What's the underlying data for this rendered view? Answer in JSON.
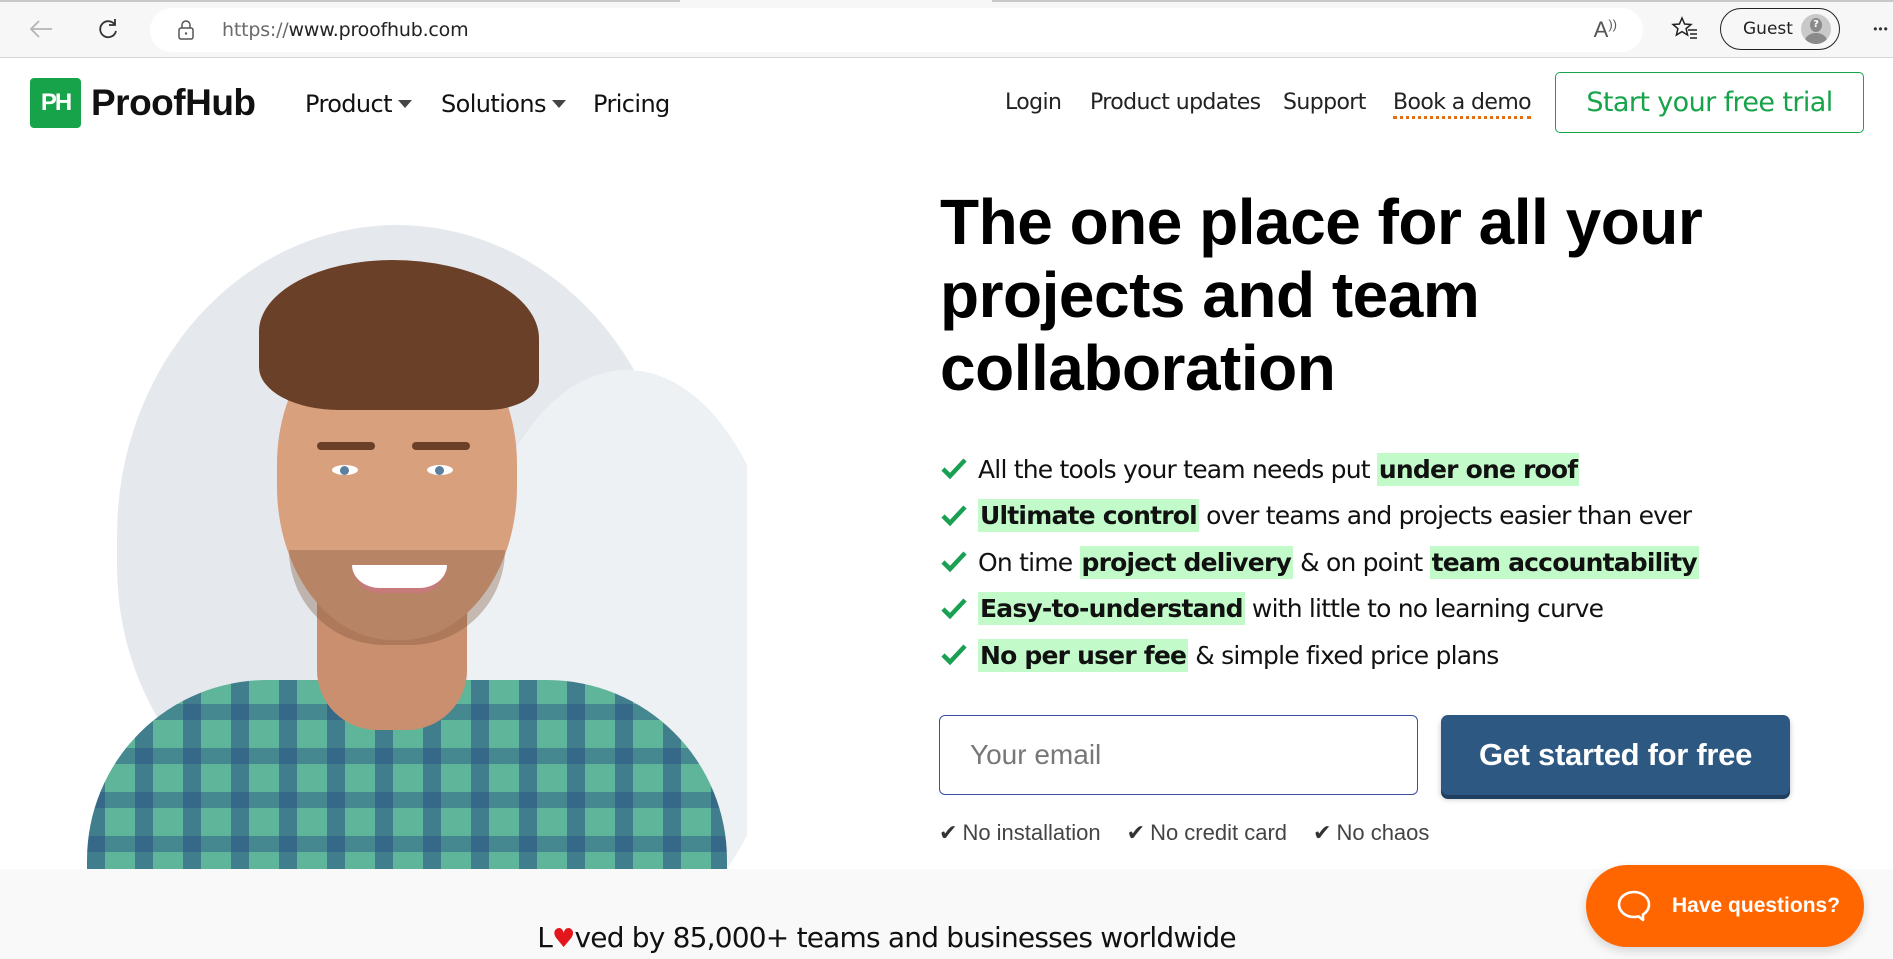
{
  "browser": {
    "url_protocol": "https://",
    "url_host": "www.proofhub.com",
    "profile_label": "Guest",
    "more_label": "•••",
    "icons": {
      "back": "arrow-left-icon",
      "reload": "reload-icon",
      "lock": "lock-icon",
      "read_aloud": "read-aloud-icon",
      "favorites": "favorites-icon",
      "profile": "avatar-icon",
      "more": "more-icon"
    }
  },
  "site": {
    "brand": {
      "mark": "PH",
      "name": "ProofHub",
      "color": "#17a34a"
    },
    "nav": [
      {
        "label": "Product",
        "has_dropdown": true
      },
      {
        "label": "Solutions",
        "has_dropdown": true
      },
      {
        "label": "Pricing",
        "has_dropdown": false
      }
    ],
    "utility_links": [
      {
        "label": "Login"
      },
      {
        "label": "Product updates"
      },
      {
        "label": "Support"
      },
      {
        "label": "Book a demo"
      }
    ],
    "cta_trial": "Start your free trial"
  },
  "hero": {
    "title": "The one place for all your projects and team collaboration",
    "features": [
      [
        {
          "text": "All the tools your team needs put ",
          "highlight": false
        },
        {
          "text": "under one roof",
          "highlight": true
        }
      ],
      [
        {
          "text": "Ultimate control",
          "highlight": true
        },
        {
          "text": " over teams and projects easier than ever",
          "highlight": false
        }
      ],
      [
        {
          "text": "On time ",
          "highlight": false
        },
        {
          "text": "project delivery",
          "highlight": true
        },
        {
          "text": " & on point ",
          "highlight": false
        },
        {
          "text": "team accountability",
          "highlight": true
        }
      ],
      [
        {
          "text": "Easy-to-understand",
          "highlight": true
        },
        {
          "text": " with little to no learning curve",
          "highlight": false
        }
      ],
      [
        {
          "text": "No per user fee",
          "highlight": true
        },
        {
          "text": " & simple fixed price plans",
          "highlight": false
        }
      ]
    ],
    "highlight_color": "#c2fbc9",
    "check_color": "#1aa053",
    "email": {
      "value": "",
      "placeholder": "Your email"
    },
    "cta_button": "Get started for free",
    "cta_color": "#2d5882",
    "perks": [
      "No installation",
      "No credit card",
      "No chaos"
    ]
  },
  "trust": {
    "prefix": "L",
    "heart": "♥",
    "suffix": "ved by 85,000+ teams and businesses worldwide"
  },
  "chat": {
    "label": "Have questions?",
    "color": "#ff6600"
  }
}
